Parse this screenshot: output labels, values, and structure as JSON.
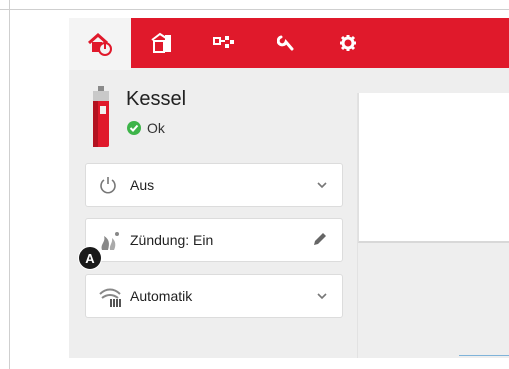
{
  "tabs": [
    {
      "name": "home-power-icon",
      "active": true
    },
    {
      "name": "boiler-room-icon",
      "active": false
    },
    {
      "name": "network-icon",
      "active": false
    },
    {
      "name": "wrench-icon",
      "active": false
    },
    {
      "name": "gear-icon",
      "active": false
    }
  ],
  "device": {
    "title": "Kessel",
    "status": "Ok"
  },
  "cards": {
    "power": {
      "label": "Aus"
    },
    "ignition": {
      "label": "Zündung: Ein"
    },
    "mode": {
      "label": "Automatik"
    }
  },
  "callout": {
    "label": "A"
  },
  "colors": {
    "accent": "#e0192b",
    "ok": "#3db449"
  }
}
